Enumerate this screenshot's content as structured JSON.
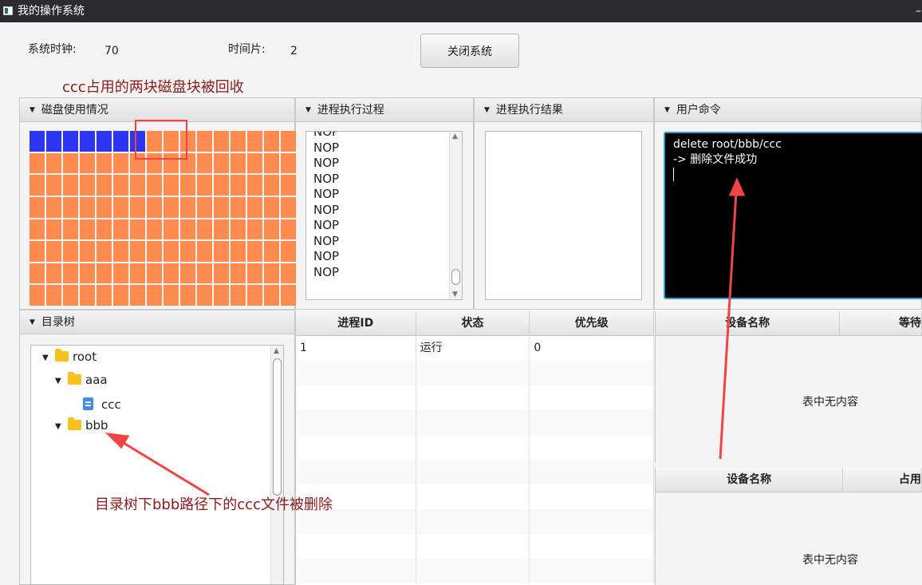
{
  "window": {
    "title": "我的操作系统",
    "control_glyph": "–"
  },
  "top": {
    "clock_label": "系统时钟:",
    "clock_value": "70",
    "slice_label": "时间片:",
    "slice_value": "2",
    "close_button": "关闭系统"
  },
  "annotations": {
    "disk_note": "ccc占用的两块磁盘块被回收",
    "tree_note": "目录树下bbb路径下的ccc文件被删除"
  },
  "panes": {
    "disk": "磁盘使用情况",
    "process_log": "进程执行过程",
    "process_result": "进程执行结果",
    "user_command": "用户命令",
    "dir_tree": "目录树"
  },
  "disk": {
    "columns": 16,
    "rows": 8,
    "used_blocks": 7,
    "used_color": "#2c35f2",
    "free_color": "#ff8b4f"
  },
  "process_log": {
    "partial_line": "NOP",
    "lines": [
      "NOP",
      "NOP",
      "NOP",
      "NOP",
      "NOP",
      "NOP",
      "NOP",
      "NOP",
      "NOP"
    ]
  },
  "terminal": {
    "command": "delete root/bbb/ccc",
    "response": "-> 删除文件成功"
  },
  "tree": {
    "root": "root",
    "aaa": "aaa",
    "ccc": "ccc",
    "bbb": "bbb"
  },
  "process_table": {
    "headers": [
      "进程ID",
      "状态",
      "优先级"
    ],
    "rows": [
      [
        "1",
        "运行",
        "0"
      ]
    ]
  },
  "device_table_1": {
    "headers": [
      "设备名称",
      "等待"
    ],
    "empty": "表中无内容"
  },
  "device_table_2": {
    "headers": [
      "设备名称",
      "占用"
    ],
    "empty": "表中无内容"
  },
  "colors": {
    "annotation": "#8b1a1a",
    "arrow": "#f04545",
    "terminal_border": "#2aa1d6"
  }
}
